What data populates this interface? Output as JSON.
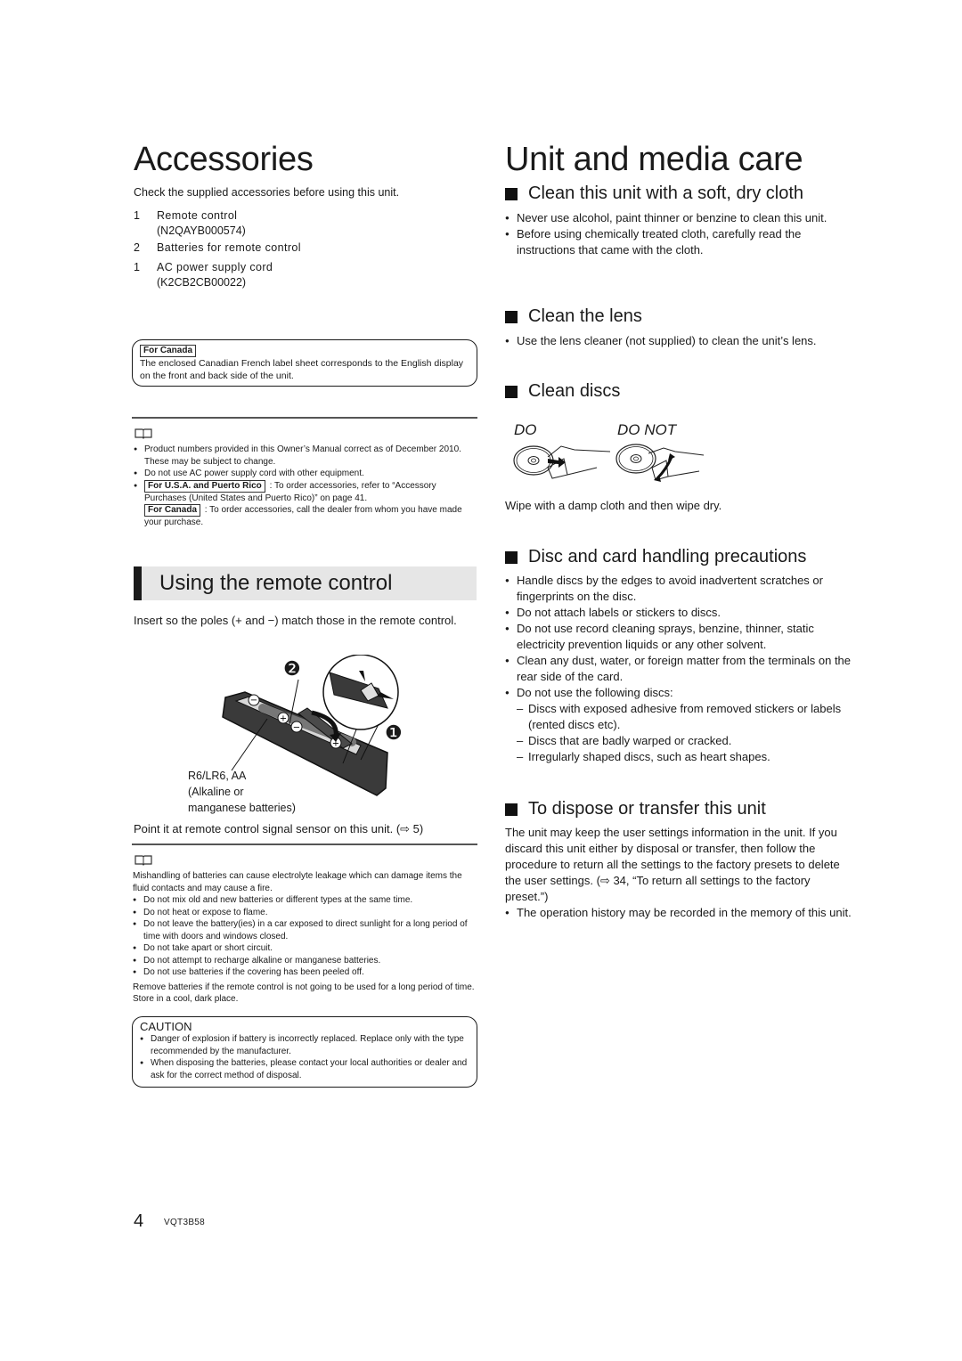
{
  "accessories": {
    "title": "Accessories",
    "intro": "Check the supplied accessories before using this unit.",
    "items": [
      {
        "qty": "1",
        "name": "Remote control",
        "code": "(N2QAYB000574)"
      },
      {
        "qty": "2",
        "name": "Batteries for remote control",
        "code": ""
      },
      {
        "qty": "1",
        "name": "AC power supply cord",
        "code": "(K2CB2CB00022)"
      }
    ],
    "canada_box": {
      "tag": "For Canada",
      "text": "The enclosed Canadian French label sheet corresponds to the English display on the front and back side of the unit."
    },
    "note_icon": "book-icon",
    "notes": [
      "Product numbers provided in this Owner’s Manual correct as of December 2010. These may be subject to change.",
      "Do not use AC power supply cord with other equipment."
    ],
    "order_note": {
      "usa_tag": "For U.S.A. and Puerto Rico",
      "usa_text": ": To order accessories, refer to “Accessory Purchases (United States and Puerto Rico)” on page 41.",
      "canada_tag": "For Canada",
      "canada_text": ": To order accessories, call the dealer from whom you have made your purchase."
    }
  },
  "remote": {
    "title": "Using the remote control",
    "intro": "Insert so the poles (+ and −) match those in the remote control.",
    "figure": {
      "step1": "❶",
      "step2": "❷",
      "battery_label_1": "R6/LR6, AA",
      "battery_label_2": "(Alkaline or",
      "battery_label_3": "manganese batteries)"
    },
    "point_text": "Point it at remote control signal sensor on this unit. (⇨ 5)",
    "note_icon": "book-icon",
    "warning_intro": "Mishandling of batteries can cause electrolyte leakage which can damage items the fluid contacts and may cause a fire.",
    "warnings": [
      "Do not mix old and new batteries or different types at the same time.",
      "Do not heat or expose to flame.",
      "Do not leave the battery(ies) in a car exposed to direct sunlight for a long period of time with doors and windows closed.",
      "Do not take apart or short circuit.",
      "Do not attempt to recharge alkaline or manganese batteries.",
      "Do not use batteries if the covering has been peeled off."
    ],
    "remove_text": "Remove batteries if the remote control is not going to be used for a long period of time. Store in a cool, dark place.",
    "caution": {
      "title": "CAUTION",
      "items": [
        "Danger of explosion if battery is incorrectly replaced. Replace only with the type recommended by the manufacturer.",
        "When disposing the batteries, please contact your local authorities or dealer and ask for the correct method of disposal."
      ]
    }
  },
  "care": {
    "title": "Unit and media care",
    "sections": {
      "cloth": {
        "heading": "Clean this unit with a soft, dry cloth",
        "items": [
          "Never use alcohol, paint thinner or benzine to clean this unit.",
          "Before using chemically treated cloth, carefully read the instructions that came with the cloth."
        ]
      },
      "lens": {
        "heading": "Clean the lens",
        "items": [
          "Use the lens cleaner (not supplied) to clean the unit’s lens."
        ]
      },
      "discs": {
        "heading": "Clean discs",
        "do_label": "DO",
        "do_not_label": "DO NOT",
        "caption": "Wipe with a damp cloth and then wipe dry."
      },
      "handling": {
        "heading": "Disc and card handling precautions",
        "items": [
          "Handle discs by the edges to avoid inadvertent scratches or fingerprints on the disc.",
          "Do not attach labels or stickers to discs.",
          "Do not use record cleaning sprays, benzine, thinner, static electricity prevention liquids or any other solvent.",
          "Clean any dust, water, or foreign matter from the terminals on the rear side of the card.",
          "Do not use the following discs:"
        ],
        "sub_items": [
          "Discs with exposed adhesive from removed stickers or labels (rented discs etc).",
          "Discs that are badly warped or cracked.",
          "Irregularly shaped discs, such as heart shapes."
        ]
      },
      "dispose": {
        "heading": "To dispose or transfer this unit",
        "body": "The unit may keep the user settings information in the unit. If you discard this unit either by disposal or transfer, then follow the procedure to return all the settings to the factory presets to delete the user settings. (⇨ 34, “To return all settings to the factory preset.”)",
        "items": [
          "The operation history may be recorded in the memory of this unit."
        ]
      }
    }
  },
  "footer": {
    "page_number": "4",
    "doc_code": "VQT3B58"
  }
}
